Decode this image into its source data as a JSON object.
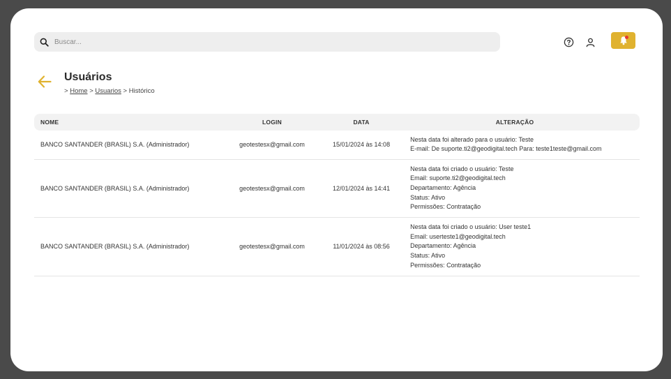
{
  "search": {
    "placeholder": "Buscar..."
  },
  "header": {
    "help_icon": "help-circle-icon",
    "user_icon": "user-icon",
    "bell_icon": "bell-icon",
    "accent": "#e0b22f",
    "notification_color": "#e53935"
  },
  "page": {
    "title": "Usuários",
    "breadcrumb": {
      "sep1": ">",
      "home": "Home",
      "sep2": ">",
      "users": "Usuarios",
      "sep3": ">",
      "current": "Histórico"
    }
  },
  "table": {
    "headers": {
      "nome": "NOME",
      "login": "LOGIN",
      "data": "DATA",
      "alteracao": "ALTERAÇÃO"
    },
    "rows": [
      {
        "nome": "BANCO SANTANDER (BRASIL) S.A. (Administrador)",
        "login": "geotestesx@gmail.com",
        "data": "15/01/2024 às 14:08",
        "alteracao": [
          "Nesta data foi alterado para o usuário: Teste",
          "E-mail: De suporte.ti2@geodigital.tech Para: teste1teste@gmail.com"
        ]
      },
      {
        "nome": "BANCO SANTANDER (BRASIL) S.A. (Administrador)",
        "login": "geotestesx@gmail.com",
        "data": "12/01/2024 às 14:41",
        "alteracao": [
          "Nesta data foi criado o usuário: Teste",
          "Email: suporte.ti2@geodigital.tech",
          "Departamento: Agência",
          "Status: Ativo",
          "Permissões: Contratação"
        ]
      },
      {
        "nome": "BANCO SANTANDER (BRASIL) S.A. (Administrador)",
        "login": "geotestesx@gmail.com",
        "data": "11/01/2024 às 08:56",
        "alteracao": [
          "Nesta data foi criado o usuário: User teste1",
          "Email: userteste1@geodigital.tech",
          "Departamento: Agência",
          "Status: Ativo",
          "Permissões: Contratação"
        ]
      }
    ]
  }
}
